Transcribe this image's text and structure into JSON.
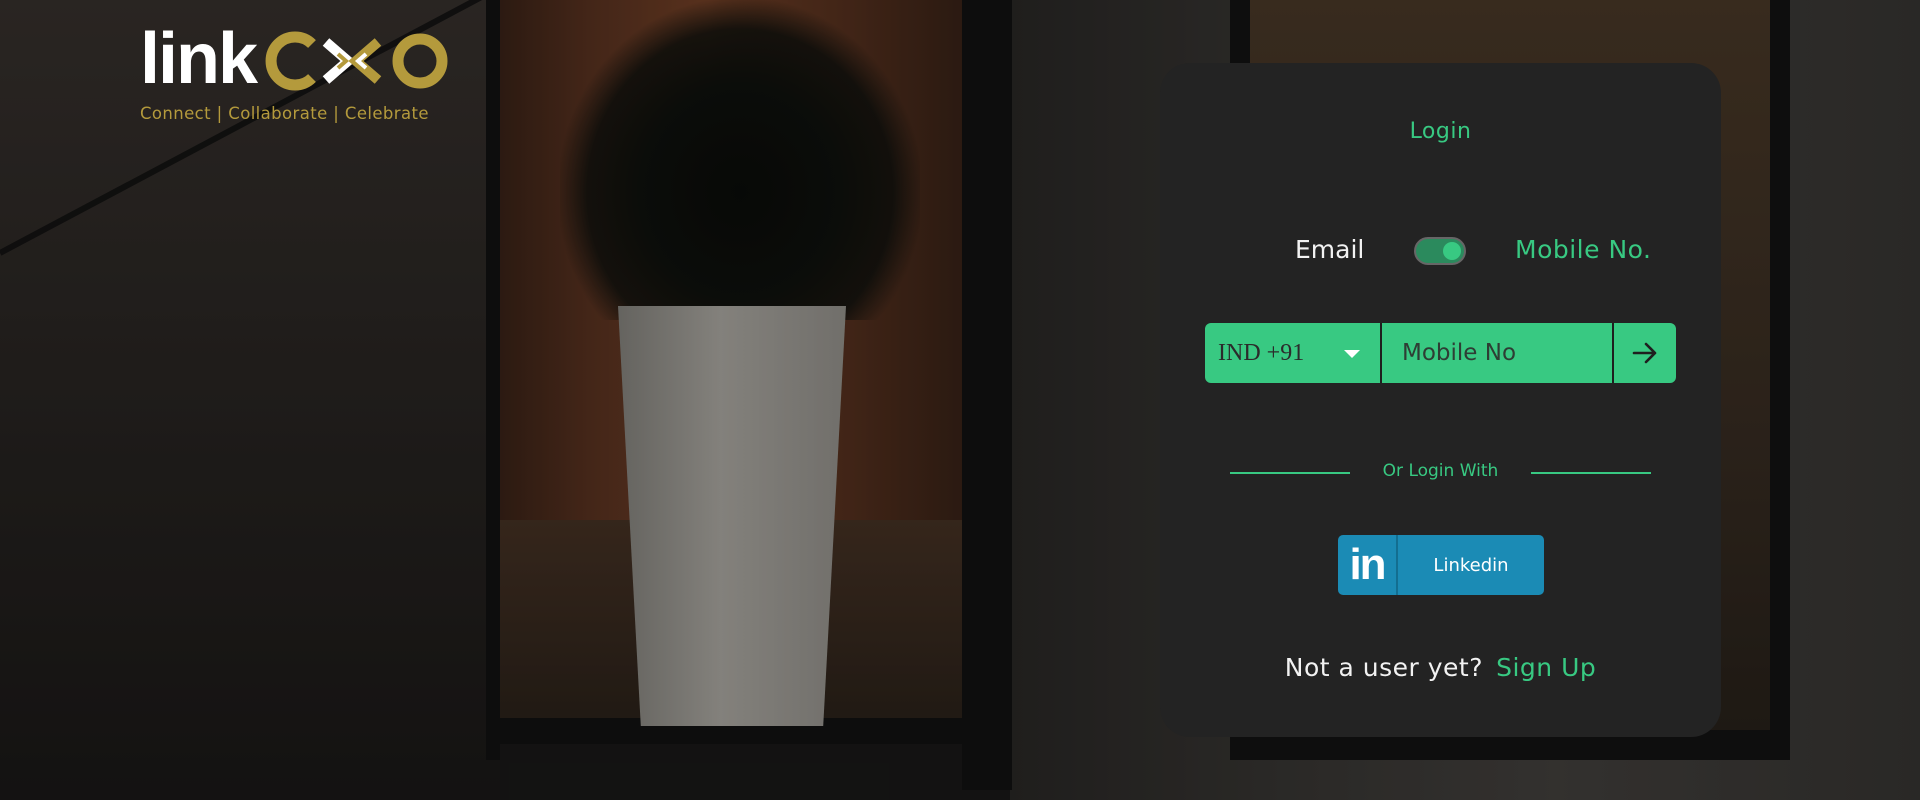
{
  "logo": {
    "word_link": "link",
    "word_cxo": "CXO",
    "tagline": "Connect | Collaborate | Celebrate"
  },
  "login": {
    "title": "Login",
    "toggle": {
      "left_label": "Email",
      "right_label": "Mobile No.",
      "selected": "Mobile No."
    },
    "country_code": "IND +91",
    "mobile_input": {
      "value": "",
      "placeholder": "Mobile No"
    },
    "submit_icon": "arrow-right-icon",
    "divider_text": "Or Login With",
    "linkedin": {
      "icon_text": "in",
      "label": "Linkedin"
    },
    "signup": {
      "question": "Not a user yet?",
      "link": "Sign Up"
    }
  },
  "colors": {
    "accent_green": "#38c982",
    "card_bg": "#232323",
    "logo_gold": "#b49a3c",
    "linkedin_blue": "#1b8bb5"
  }
}
